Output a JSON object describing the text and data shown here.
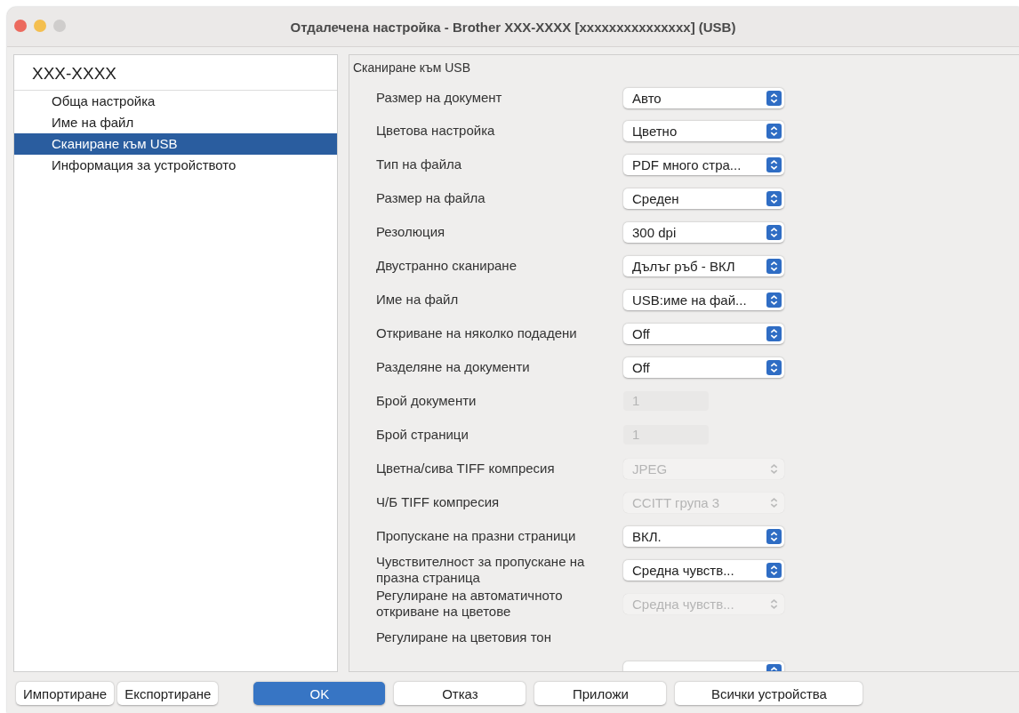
{
  "window": {
    "title": "Отдалечена настройка - Brother XXX-XXXX [xxxxxxxxxxxxxxx] (USB)"
  },
  "sidebar": {
    "device": "XXX-XXXX",
    "items": [
      {
        "label": "Обща настройка",
        "selected": false
      },
      {
        "label": "Име на файл",
        "selected": false
      },
      {
        "label": "Сканиране към USB",
        "selected": true
      },
      {
        "label": "Информация за устройството",
        "selected": false
      }
    ]
  },
  "panel": {
    "title": "Сканиране към USB",
    "rows": [
      {
        "kind": "popup",
        "label": "Размер на документ",
        "value": "Авто",
        "disabled": false
      },
      {
        "kind": "popup",
        "label": "Цветова настройка",
        "value": "Цветно",
        "disabled": false
      },
      {
        "kind": "popup",
        "label": "Тип на файла",
        "value": "PDF много стра...",
        "disabled": false
      },
      {
        "kind": "popup",
        "label": "Размер на файла",
        "value": "Среден",
        "disabled": false
      },
      {
        "kind": "popup",
        "label": "Резолюция",
        "value": "300 dpi",
        "disabled": false
      },
      {
        "kind": "popup",
        "label": "Двустранно сканиране",
        "value": "Дълъг ръб - ВКЛ",
        "disabled": false
      },
      {
        "kind": "popup",
        "label": "Име на файл",
        "value": "USB:име на фай...",
        "disabled": false
      },
      {
        "kind": "popup",
        "label": "Откриване на няколко подадени",
        "value": "Off",
        "disabled": false
      },
      {
        "kind": "popup",
        "label": "Разделяне на документи",
        "value": "Off",
        "disabled": false
      },
      {
        "kind": "field",
        "label": "Брой документи",
        "value": "1",
        "disabled": true
      },
      {
        "kind": "field",
        "label": "Брой страници",
        "value": "1",
        "disabled": true
      },
      {
        "kind": "popup",
        "label": "Цветна/сива TIFF компресия",
        "value": "JPEG",
        "disabled": true
      },
      {
        "kind": "popup",
        "label": "Ч/Б TIFF компресия",
        "value": "CCITT група 3",
        "disabled": true
      },
      {
        "kind": "popup",
        "label": "Пропускане на празни страници",
        "value": "ВКЛ.",
        "disabled": false
      },
      {
        "kind": "popup",
        "label": "Чувствителност за пропускане на празна страница",
        "value": "Средна чувств...",
        "disabled": false
      },
      {
        "kind": "popup",
        "label": "Регулиране на автоматичното откриване на цветове",
        "value": "Средна чувств...",
        "disabled": true
      },
      {
        "kind": "heading",
        "label": "Регулиране на цветовия тон"
      },
      {
        "kind": "popup",
        "disabled": false
      }
    ]
  },
  "buttons_left": [
    "Импортиране",
    "Експортиране"
  ],
  "buttons": [
    {
      "label": "OK",
      "default": true
    },
    {
      "label": "Отказ",
      "default": false
    },
    {
      "label": "Приложи",
      "default": false
    },
    {
      "label": "Всички устройства",
      "default": false
    }
  ]
}
